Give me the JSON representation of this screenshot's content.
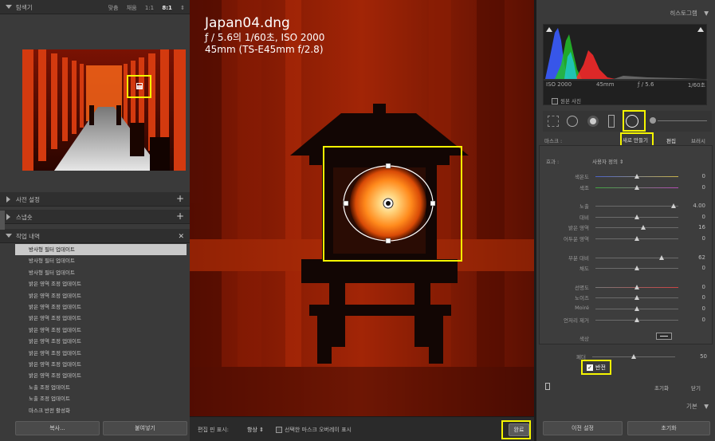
{
  "navigator": {
    "title": "탐색기",
    "options": [
      "맞춤",
      "채움",
      "1:1",
      "8:1"
    ],
    "active_option": "8:1"
  },
  "left_panels": {
    "presets": "사전 설정",
    "snapshots": "스냅숏",
    "history": "작업 내역",
    "history_close": "✕"
  },
  "history_items": [
    "방사형 필터 업데이트",
    "방사형 필터 업데이트",
    "방사형 필터 업데이트",
    "밝은 영역 조정 업데이트",
    "밝은 영역 조정 업데이트",
    "밝은 영역 조정 업데이트",
    "밝은 영역 조정 업데이트",
    "밝은 영역 조정 업데이트",
    "밝은 영역 조정 업데이트",
    "밝은 영역 조정 업데이트",
    "밝은 영역 조정 업데이트",
    "밝은 영역 조정 업데이트",
    "노출 조정 업데이트",
    "노출 조정 업데이트",
    "마스크 반전 활성화"
  ],
  "left_buttons": {
    "copy": "복사...",
    "paste": "붙여넣기"
  },
  "photo": {
    "filename": "Japan04.dng",
    "exposure": "ƒ / 5.6의 1/60초, ISO 2000",
    "lens": "45mm (TS-E45mm f/2.8)"
  },
  "toolbar": {
    "edit_pins_label": "편집 핀 표시:",
    "edit_pins_value": "항상",
    "overlay_label": "선택한 마스크 오버레이 표시",
    "done": "완료"
  },
  "histogram": {
    "title": "히스토그램",
    "iso": "ISO 2000",
    "focal": "45mm",
    "aperture": "ƒ / 5.6",
    "shutter": "1/60초",
    "original_photo": "원본 사진"
  },
  "mask": {
    "label": "마스크 :",
    "new": "새로 만들기",
    "edit": "편집",
    "brush": "브러시"
  },
  "effect": {
    "label": "효과 :",
    "value": "사용자 정의"
  },
  "sliders": [
    {
      "label": "색온도",
      "value": "0",
      "pos": 0.5,
      "group": 1
    },
    {
      "label": "색조",
      "value": "0",
      "pos": 0.5,
      "group": 1
    },
    {
      "label": "노출",
      "value": "4.00",
      "pos": 0.95,
      "group": 2
    },
    {
      "label": "대비",
      "value": "0",
      "pos": 0.5,
      "group": 2
    },
    {
      "label": "밝은 영역",
      "value": "16",
      "pos": 0.58,
      "group": 2
    },
    {
      "label": "어두운 영역",
      "value": "0",
      "pos": 0.5,
      "group": 2
    },
    {
      "label": "부분 대비",
      "value": "62",
      "pos": 0.8,
      "group": 3
    },
    {
      "label": "채도",
      "value": "0",
      "pos": 0.5,
      "group": 3
    },
    {
      "label": "선명도",
      "value": "0",
      "pos": 0.5,
      "group": 4
    },
    {
      "label": "노이즈",
      "value": "0",
      "pos": 0.5,
      "group": 4
    },
    {
      "label": "Moiré",
      "value": "0",
      "pos": 0.5,
      "group": 4
    },
    {
      "label": "언저리 제거",
      "value": "0",
      "pos": 0.5,
      "group": 4
    }
  ],
  "color_label": "색상",
  "feather": {
    "label": "페더",
    "value": "50",
    "pos": 0.5
  },
  "invert": {
    "label": "반전",
    "checked": true
  },
  "bottom_row": {
    "reset": "초기화",
    "close": "닫기"
  },
  "basic": "기본",
  "right_buttons": {
    "previous": "이전 설정",
    "reset": "초기화"
  }
}
